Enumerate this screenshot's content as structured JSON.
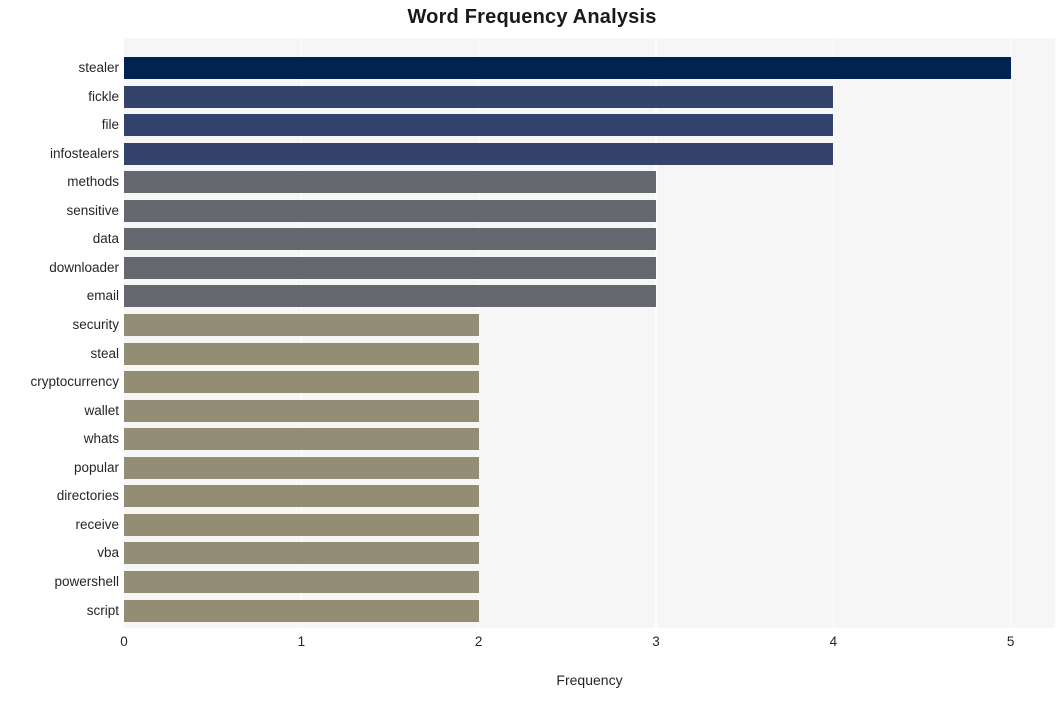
{
  "chart_data": {
    "type": "bar",
    "orientation": "horizontal",
    "title": "Word Frequency Analysis",
    "xlabel": "Frequency",
    "ylabel": "",
    "xlim": [
      0,
      5.25
    ],
    "xticks": [
      "0",
      "1",
      "2",
      "3",
      "4",
      "5"
    ],
    "xtick_values": [
      0,
      1,
      2,
      3,
      4,
      5
    ],
    "grid": "vertical",
    "legend": "none",
    "categories": [
      "stealer",
      "fickle",
      "file",
      "infostealers",
      "methods",
      "sensitive",
      "data",
      "downloader",
      "email",
      "security",
      "steal",
      "cryptocurrency",
      "wallet",
      "whats",
      "popular",
      "directories",
      "receive",
      "vba",
      "powershell",
      "script"
    ],
    "values": [
      5,
      4,
      4,
      4,
      3,
      3,
      3,
      3,
      3,
      2,
      2,
      2,
      2,
      2,
      2,
      2,
      2,
      2,
      2,
      2
    ],
    "bar_colors": [
      "#00234f",
      "#34436b",
      "#34436b",
      "#34436b",
      "#65686f",
      "#65686f",
      "#65686f",
      "#65686f",
      "#65686f",
      "#938d76",
      "#938d76",
      "#938d76",
      "#938d76",
      "#938d76",
      "#938d76",
      "#938d76",
      "#938d76",
      "#938d76",
      "#938d76",
      "#938d76"
    ]
  },
  "style": {
    "panel_background": "#f6f6f7",
    "figure_background": "#ffffff",
    "gridline_color": "#ffffff",
    "text_color": "#262626",
    "title_color": "#1a1a1a"
  }
}
